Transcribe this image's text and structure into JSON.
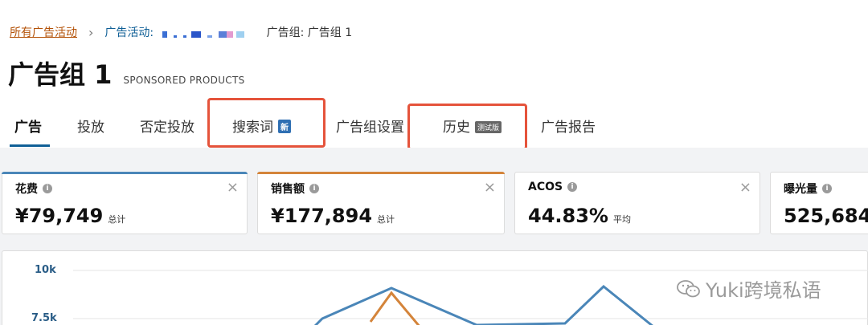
{
  "breadcrumb": {
    "all_campaigns": "所有广告活动",
    "campaign_prefix": "广告活动:",
    "ad_group": "广告组: 广告组 1"
  },
  "page": {
    "title": "广告组 1",
    "subtitle": "SPONSORED PRODUCTS"
  },
  "tabs": [
    {
      "label": "广告",
      "active": true
    },
    {
      "label": "投放"
    },
    {
      "label": "否定投放"
    },
    {
      "label": "搜索词",
      "badge": "新"
    },
    {
      "label": "广告组设置"
    },
    {
      "label": "历史",
      "badge": "测试版"
    },
    {
      "label": "广告报告"
    }
  ],
  "metrics": [
    {
      "label": "花费",
      "value": "¥79,749",
      "unit": "总计",
      "accent": "#4a86b8"
    },
    {
      "label": "销售额",
      "value": "¥177,894",
      "unit": "总计",
      "accent": "#d4843a"
    },
    {
      "label": "ACOS",
      "value": "44.83%",
      "unit": "平均",
      "accent": ""
    },
    {
      "label": "曝光量",
      "value": "525,684",
      "unit": "",
      "accent": ""
    }
  ],
  "chart_data": {
    "type": "line",
    "y_ticks": [
      "10k",
      "7.5k"
    ],
    "series": [
      {
        "color": "#4a86b8"
      },
      {
        "color": "#d4843a"
      }
    ]
  },
  "watermark": "Yuki跨境私语",
  "colors": {
    "link": "#b45309",
    "primary": "#0f5f96",
    "highlight": "#e5533b"
  }
}
